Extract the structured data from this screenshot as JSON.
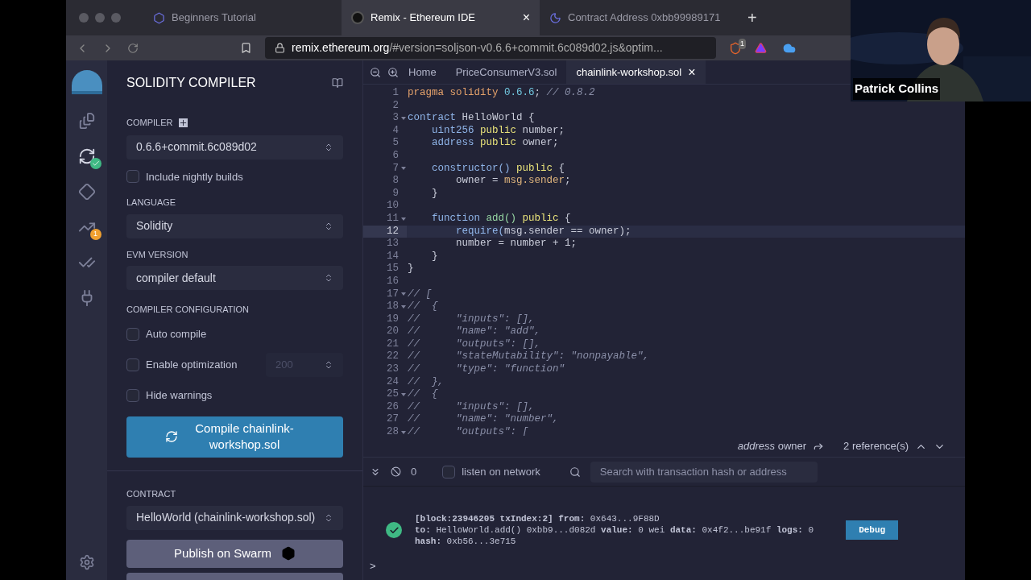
{
  "browser": {
    "tabs": [
      {
        "label": "Beginners Tutorial",
        "selected": false
      },
      {
        "label": "Remix - Ethereum IDE",
        "selected": true,
        "close": "×"
      },
      {
        "label": "Contract Address 0xbb99989171",
        "selected": false
      }
    ],
    "new_tab": "+",
    "url": {
      "host": "remix.ethereum.org",
      "path": "/#version=soljson-v0.6.6+commit.6c089d02.js&optim..."
    },
    "shield_badge": "1"
  },
  "icon_bar": {
    "items": [
      {
        "kind": "files",
        "selected": false
      },
      {
        "kind": "compiler",
        "selected": true
      },
      {
        "kind": "deploy",
        "selected": false
      },
      {
        "kind": "analysis",
        "selected": false,
        "badge": "1"
      },
      {
        "kind": "tests",
        "selected": false
      },
      {
        "kind": "plugins",
        "selected": false
      }
    ]
  },
  "compiler_panel": {
    "title": "SOLIDITY COMPILER",
    "compiler": {
      "label": "COMPILER",
      "value": "0.6.6+commit.6c089d02"
    },
    "nightly": {
      "label": "Include nightly builds",
      "checked": false
    },
    "language": {
      "label": "LANGUAGE",
      "value": "Solidity"
    },
    "evm": {
      "label": "EVM VERSION",
      "value": "compiler default"
    },
    "config": {
      "label": "COMPILER CONFIGURATION",
      "options": [
        {
          "label": "Auto compile",
          "checked": false
        },
        {
          "label": "Enable optimization",
          "checked": false,
          "runs": "200"
        },
        {
          "label": "Hide warnings",
          "checked": false
        }
      ]
    },
    "compile_button": "Compile chainlink-workshop.sol",
    "contract": {
      "label": "CONTRACT",
      "value": "HelloWorld (chainlink-workshop.sol)"
    },
    "publish_button": "Publish on Swarm"
  },
  "editor": {
    "tabs": [
      {
        "label": "Home",
        "selected": false
      },
      {
        "label": "PriceConsumerV3.sol",
        "selected": false
      },
      {
        "label": "chainlink-workshop.sol",
        "selected": true,
        "close": "×"
      }
    ],
    "lines": [
      {
        "n": "1",
        "fold": false,
        "active": false,
        "segs": [
          {
            "kind": "kw",
            "t": "pragma solidity "
          },
          {
            "kind": "num",
            "t": "0.6.6"
          },
          {
            "kind": "id",
            "t": "; "
          },
          {
            "kind": "cm",
            "t": "// 0.8.2"
          }
        ]
      },
      {
        "n": "2",
        "fold": false,
        "active": false
      },
      {
        "n": "3",
        "fold": true,
        "active": false,
        "segs": [
          {
            "kind": "ty",
            "t": "contract "
          },
          {
            "kind": "id",
            "t": "HelloWorld {"
          }
        ]
      },
      {
        "n": "4",
        "fold": false,
        "active": false,
        "segs": [
          {
            "kind": "ty",
            "t": "    uint256 "
          },
          {
            "kind": "mod",
            "t": "public "
          },
          {
            "kind": "id",
            "t": "number;"
          }
        ]
      },
      {
        "n": "5",
        "fold": false,
        "active": false,
        "segs": [
          {
            "kind": "ty",
            "t": "    address "
          },
          {
            "kind": "mod",
            "t": "public "
          },
          {
            "kind": "id",
            "t": "owner;"
          }
        ]
      },
      {
        "n": "6",
        "fold": false,
        "active": false
      },
      {
        "n": "7",
        "fold": true,
        "active": false,
        "segs": [
          {
            "kind": "ty",
            "t": "    constructor() "
          },
          {
            "kind": "mod",
            "t": "public "
          },
          {
            "kind": "id",
            "t": "{"
          }
        ]
      },
      {
        "n": "8",
        "fold": false,
        "active": false,
        "segs": [
          {
            "kind": "id",
            "t": "        owner = "
          },
          {
            "kind": "msg",
            "t": "msg.sender"
          },
          {
            "kind": "id",
            "t": ";"
          }
        ]
      },
      {
        "n": "9",
        "fold": false,
        "active": false,
        "segs": [
          {
            "kind": "id",
            "t": "    }"
          }
        ]
      },
      {
        "n": "10",
        "fold": false,
        "active": false
      },
      {
        "n": "11",
        "fold": true,
        "active": false,
        "segs": [
          {
            "kind": "ty",
            "t": "    function "
          },
          {
            "kind": "fn",
            "t": "add() "
          },
          {
            "kind": "mod",
            "t": "public "
          },
          {
            "kind": "id",
            "t": "{"
          }
        ]
      },
      {
        "n": "12",
        "fold": false,
        "active": true,
        "segs": [
          {
            "kind": "ty",
            "t": "        require("
          },
          {
            "kind": "id",
            "t": "msg.sender == owner);"
          }
        ]
      },
      {
        "n": "13",
        "fold": false,
        "active": false,
        "segs": [
          {
            "kind": "id",
            "t": "        number = number + 1;"
          }
        ]
      },
      {
        "n": "14",
        "fold": false,
        "active": false,
        "segs": [
          {
            "kind": "id",
            "t": "    }"
          }
        ]
      },
      {
        "n": "15",
        "fold": false,
        "active": false,
        "segs": [
          {
            "kind": "id",
            "t": "}"
          }
        ]
      },
      {
        "n": "16",
        "fold": false,
        "active": false
      },
      {
        "n": "17",
        "fold": true,
        "active": false,
        "segs": [
          {
            "kind": "cm",
            "t": "// ["
          }
        ]
      },
      {
        "n": "18",
        "fold": true,
        "active": false,
        "segs": [
          {
            "kind": "cm",
            "t": "//  {"
          }
        ]
      },
      {
        "n": "19",
        "fold": false,
        "active": false,
        "segs": [
          {
            "kind": "cm",
            "t": "//      \"inputs\": [],"
          }
        ]
      },
      {
        "n": "20",
        "fold": false,
        "active": false,
        "segs": [
          {
            "kind": "cm",
            "t": "//      \"name\": \"add\","
          }
        ]
      },
      {
        "n": "21",
        "fold": false,
        "active": false,
        "segs": [
          {
            "kind": "cm",
            "t": "//      \"outputs\": [],"
          }
        ]
      },
      {
        "n": "22",
        "fold": false,
        "active": false,
        "segs": [
          {
            "kind": "cm",
            "t": "//      \"stateMutability\": \"nonpayable\","
          }
        ]
      },
      {
        "n": "23",
        "fold": false,
        "active": false,
        "segs": [
          {
            "kind": "cm",
            "t": "//      \"type\": \"function\""
          }
        ]
      },
      {
        "n": "24",
        "fold": false,
        "active": false,
        "segs": [
          {
            "kind": "cm",
            "t": "//  },"
          }
        ]
      },
      {
        "n": "25",
        "fold": true,
        "active": false,
        "segs": [
          {
            "kind": "cm",
            "t": "//  {"
          }
        ]
      },
      {
        "n": "26",
        "fold": false,
        "active": false,
        "segs": [
          {
            "kind": "cm",
            "t": "//      \"inputs\": [],"
          }
        ]
      },
      {
        "n": "27",
        "fold": false,
        "active": false,
        "segs": [
          {
            "kind": "cm",
            "t": "//      \"name\": \"number\","
          }
        ]
      },
      {
        "n": "28",
        "fold": true,
        "active": false,
        "segs": [
          {
            "kind": "cm",
            "t": "//      \"outputs\": ["
          }
        ]
      }
    ],
    "references": {
      "type": "address",
      "name": "owner",
      "count": "2 reference(s)"
    }
  },
  "terminal": {
    "count": "0",
    "listen": {
      "label": "listen on network",
      "checked": false
    },
    "search": {
      "placeholder": "Search with transaction hash or address"
    },
    "log": {
      "succeeded": true,
      "lines": [
        "**[block:23946205 txIndex:2]**  **from:** 0x643...9F88D",
        "**to:** HelloWorld.add() 0xbb9...d082d **value:** 0 wei **data:** 0x4f2...be91f **logs:** 0",
        "**hash:** 0xb56...3e715"
      ],
      "debug_button": "Debug"
    },
    "prompt": ">"
  },
  "webcam": {
    "name": "Patrick Collins"
  }
}
